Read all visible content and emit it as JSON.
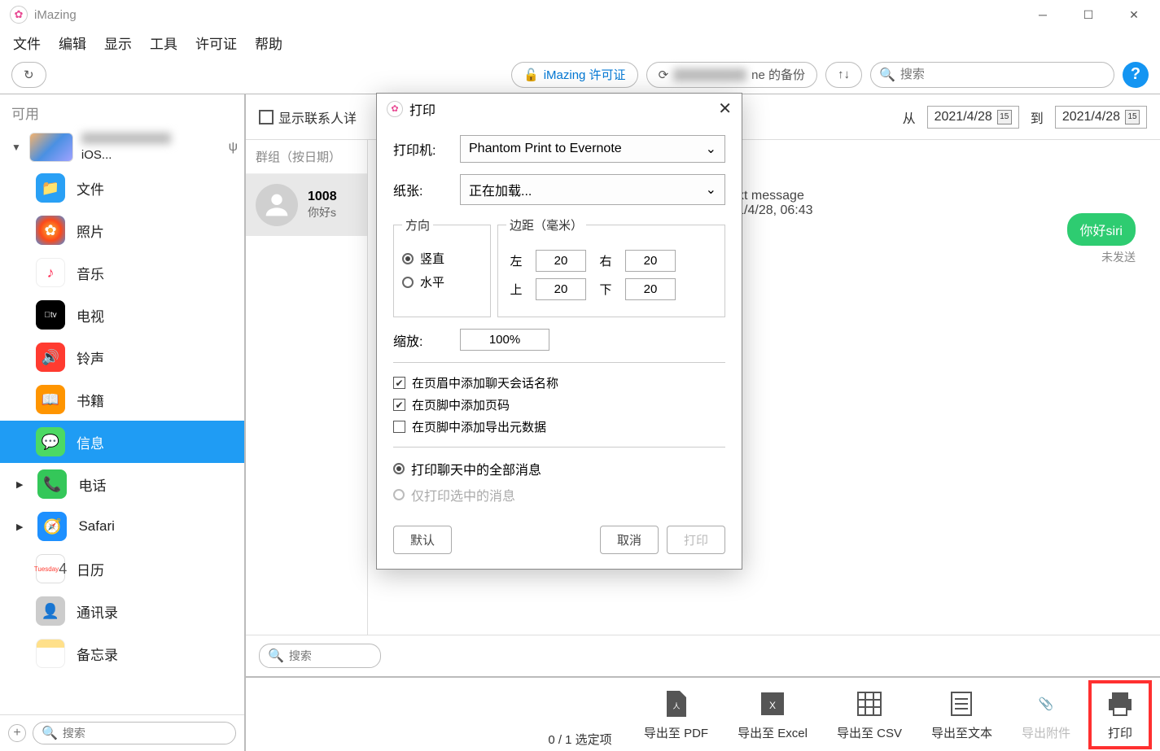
{
  "app": {
    "title": "iMazing"
  },
  "menu": [
    "文件",
    "编辑",
    "显示",
    "工具",
    "许可证",
    "帮助"
  ],
  "toolbar": {
    "license": "iMazing 许可证",
    "backup_suffix": "ne 的备份",
    "search_placeholder": "搜索"
  },
  "sidebar": {
    "header": "可用",
    "device_sub": "iOS...",
    "items": [
      {
        "label": "文件",
        "icon": "folder"
      },
      {
        "label": "照片",
        "icon": "photos"
      },
      {
        "label": "音乐",
        "icon": "music"
      },
      {
        "label": "电视",
        "icon": "tv"
      },
      {
        "label": "铃声",
        "icon": "ringtone"
      },
      {
        "label": "书籍",
        "icon": "books"
      },
      {
        "label": "信息",
        "icon": "messages",
        "active": true
      },
      {
        "label": "电话",
        "icon": "phone",
        "chev": true
      },
      {
        "label": "Safari",
        "icon": "safari",
        "chev": true
      },
      {
        "label": "日历",
        "icon": "calendar"
      },
      {
        "label": "通讯录",
        "icon": "contacts"
      },
      {
        "label": "备忘录",
        "icon": "notes"
      }
    ],
    "search_placeholder": "搜索"
  },
  "filter": {
    "show_contact_details": "显示联系人详",
    "from_label": "从",
    "from_date": "2021/4/28",
    "to_label": "到",
    "to_date": "2021/4/28",
    "cal_day": "15"
  },
  "groups": {
    "header": "群组（按日期）",
    "item": {
      "title": "1008",
      "preview": "你好s"
    }
  },
  "chat": {
    "meta1": "Text message",
    "meta2": "2021/4/28, 06:43",
    "bubble": "你好siri",
    "status": "未发送",
    "search_placeholder": "搜索"
  },
  "actions": {
    "pdf": "导出至 PDF",
    "excel": "导出至 Excel",
    "csv": "导出至 CSV",
    "text": "导出至文本",
    "attach": "导出附件",
    "print": "打印"
  },
  "status_line": "0 / 1 选定项",
  "dialog": {
    "title": "打印",
    "printer_label": "打印机:",
    "printer_value": "Phantom Print to Evernote",
    "paper_label": "纸张:",
    "paper_value": "正在加载...",
    "orient_legend": "方向",
    "orient_vertical": "竖直",
    "orient_horizontal": "水平",
    "margin_legend": "边距（毫米）",
    "left": "左",
    "right": "右",
    "top": "上",
    "bottom": "下",
    "m_left": "20",
    "m_right": "20",
    "m_top": "20",
    "m_bottom": "20",
    "zoom_label": "缩放:",
    "zoom_value": "100%",
    "chk1": "在页眉中添加聊天会话名称",
    "chk2": "在页脚中添加页码",
    "chk3": "在页脚中添加导出元数据",
    "rad_all": "打印聊天中的全部消息",
    "rad_sel": "仅打印选中的消息",
    "btn_default": "默认",
    "btn_cancel": "取消",
    "btn_print": "打印"
  }
}
